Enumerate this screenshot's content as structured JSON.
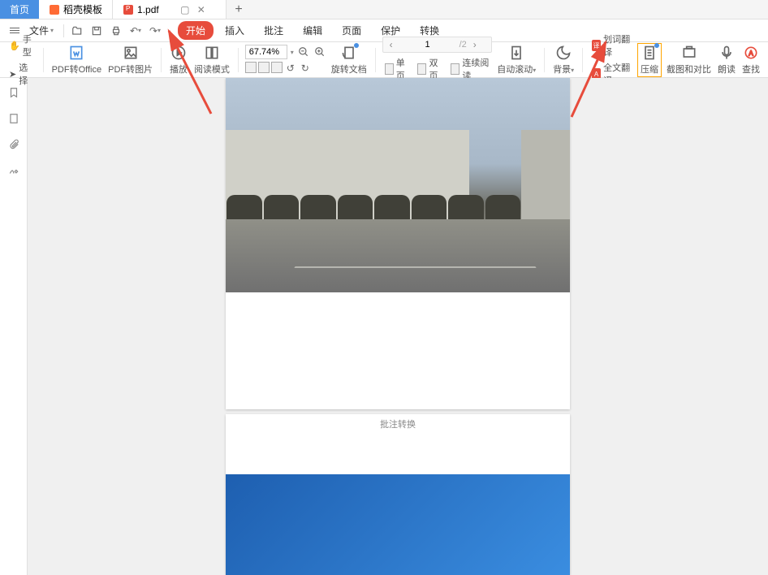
{
  "tabs": {
    "home": "首页",
    "template": "稻壳模板",
    "file": "1.pdf"
  },
  "menubar": {
    "file": "文件",
    "items": [
      "开始",
      "插入",
      "批注",
      "编辑",
      "页面",
      "保护",
      "转换"
    ]
  },
  "toolbar": {
    "hand": "手型",
    "select": "选择",
    "pdf_office": "PDF转Office",
    "pdf_image": "PDF转图片",
    "play": "播放",
    "read_mode": "阅读模式",
    "zoom_value": "67.74%",
    "rotate": "旋转文档",
    "page_current": "1",
    "page_total": "/2",
    "single_page": "单页",
    "double_page": "双页",
    "continuous": "连续阅读",
    "auto_scroll": "自动滚动",
    "background": "背景",
    "word_translate": "划词翻译",
    "full_translate": "全文翻译",
    "compress": "压缩",
    "screenshot": "截图和对比",
    "read_aloud": "朗读",
    "find": "查找"
  },
  "page2_text": "批注转换"
}
